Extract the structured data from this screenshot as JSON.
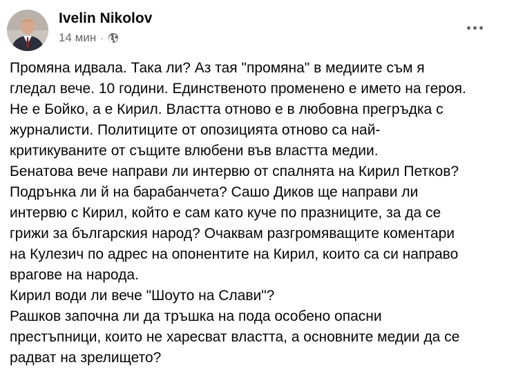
{
  "post": {
    "author": {
      "name": "Ivelin Nikolov"
    },
    "timestamp": "14 мин",
    "separator": "·",
    "privacy_icon": "globe-icon",
    "more_icon": "more-options-icon",
    "body_lines": [
      "Промяна идвала. Така ли? Аз тая \"промяна\" в медиите съм я",
      "гледал вече. 10 години. Единственото променено е името на героя.",
      "Не е Бойко, а е Кирил. Властта отново е в любовна прегръдка с",
      "журналисти. Политиците от опозицията отново са най-",
      "критикуваните от същите влюбени във властта медии.",
      "Бенатова вече направи ли интервю от спалнята на Кирил Петков?",
      "Подрънка ли й на барабанчета? Сашо Диков ще направи ли",
      "интервю с Кирил, който е сам като куче по празниците, за да се",
      "грижи за българския народ? Очаквам разгромяващите коментари",
      "на Кулезич по адрес на опонентите на Кирил, които са си направо",
      "врагове на народа.",
      "Кирил води ли вече \"Шоуто на Слави\"?",
      "Рашков започна ли да тръшка на пода особено опасни",
      "престъпници, които не харесват властта, а основните медии да се",
      "радват на зрелището?"
    ]
  }
}
